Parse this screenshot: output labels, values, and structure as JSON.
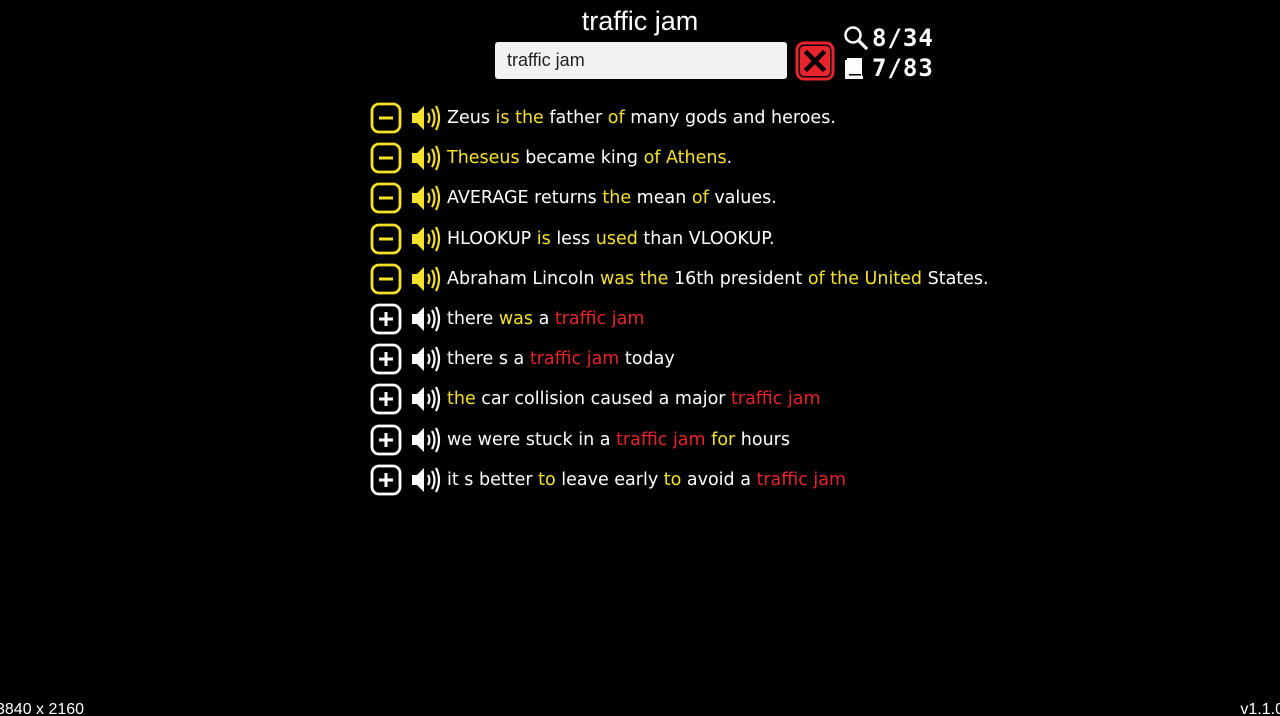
{
  "title": "traffic jam",
  "search": {
    "value": "traffic jam"
  },
  "stats": {
    "search_count": "8/34",
    "book_count": "7/83"
  },
  "colors": {
    "background": "#000000",
    "highlight_yellow": "#f5e12b",
    "match_red": "#e8232b",
    "text_white": "#ffffff",
    "clear_button": "#e8232b"
  },
  "sentences": [
    {
      "mode": "minus",
      "segments": [
        {
          "t": "Zeus",
          "c": "w"
        },
        {
          "t": " ",
          "c": "w"
        },
        {
          "t": "is the",
          "c": "y"
        },
        {
          "t": " father ",
          "c": "w"
        },
        {
          "t": "of",
          "c": "y"
        },
        {
          "t": " many gods and heroes.",
          "c": "w"
        }
      ]
    },
    {
      "mode": "minus",
      "segments": [
        {
          "t": "Theseus",
          "c": "y"
        },
        {
          "t": " became king ",
          "c": "w"
        },
        {
          "t": "of Athens",
          "c": "y"
        },
        {
          "t": ".",
          "c": "w"
        }
      ]
    },
    {
      "mode": "minus",
      "segments": [
        {
          "t": "AVERAGE returns ",
          "c": "w"
        },
        {
          "t": "the",
          "c": "y"
        },
        {
          "t": " mean ",
          "c": "w"
        },
        {
          "t": "of",
          "c": "y"
        },
        {
          "t": " values.",
          "c": "w"
        }
      ]
    },
    {
      "mode": "minus",
      "segments": [
        {
          "t": "HLOOKUP ",
          "c": "w"
        },
        {
          "t": "is",
          "c": "y"
        },
        {
          "t": " less ",
          "c": "w"
        },
        {
          "t": "used",
          "c": "y"
        },
        {
          "t": " than VLOOKUP.",
          "c": "w"
        }
      ]
    },
    {
      "mode": "minus",
      "segments": [
        {
          "t": "Abraham Lincoln ",
          "c": "w"
        },
        {
          "t": "was the",
          "c": "y"
        },
        {
          "t": " 16th president ",
          "c": "w"
        },
        {
          "t": "of the United",
          "c": "y"
        },
        {
          "t": " States.",
          "c": "w"
        }
      ]
    },
    {
      "mode": "plus",
      "segments": [
        {
          "t": "there ",
          "c": "w"
        },
        {
          "t": "was",
          "c": "y"
        },
        {
          "t": " a ",
          "c": "w"
        },
        {
          "t": "traffic jam",
          "c": "r"
        }
      ]
    },
    {
      "mode": "plus",
      "segments": [
        {
          "t": "there s a ",
          "c": "w"
        },
        {
          "t": "traffic jam",
          "c": "r"
        },
        {
          "t": " today",
          "c": "w"
        }
      ]
    },
    {
      "mode": "plus",
      "segments": [
        {
          "t": "the",
          "c": "y"
        },
        {
          "t": " car collision caused a major ",
          "c": "w"
        },
        {
          "t": "traffic jam",
          "c": "r"
        }
      ]
    },
    {
      "mode": "plus",
      "segments": [
        {
          "t": "we were stuck in a ",
          "c": "w"
        },
        {
          "t": "traffic jam",
          "c": "r"
        },
        {
          "t": " ",
          "c": "w"
        },
        {
          "t": "for",
          "c": "y"
        },
        {
          "t": " hours",
          "c": "w"
        }
      ]
    },
    {
      "mode": "plus",
      "segments": [
        {
          "t": "it s better ",
          "c": "w"
        },
        {
          "t": "to",
          "c": "y"
        },
        {
          "t": " leave early ",
          "c": "w"
        },
        {
          "t": "to",
          "c": "y"
        },
        {
          "t": " avoid a ",
          "c": "w"
        },
        {
          "t": "traffic jam",
          "c": "r"
        }
      ]
    }
  ],
  "footer": {
    "resolution": "3840 x 2160",
    "version": "v1.1.0"
  }
}
